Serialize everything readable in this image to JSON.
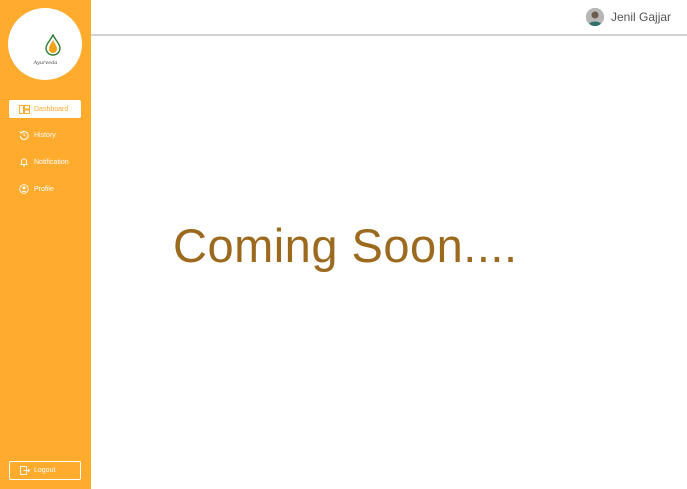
{
  "logo": {
    "text": "Ayurveda"
  },
  "sidebar": {
    "items": [
      {
        "label": "Dashboard",
        "icon": "dashboard-icon",
        "active": true
      },
      {
        "label": "History",
        "icon": "history-icon",
        "active": false
      },
      {
        "label": "Notification",
        "icon": "bell-icon",
        "active": false
      },
      {
        "label": "Profile",
        "icon": "user-circle-icon",
        "active": false
      }
    ],
    "logout_label": "Logout"
  },
  "header": {
    "user_name": "Jenil Gajjar"
  },
  "main": {
    "message": "Coming Soon...."
  },
  "colors": {
    "accent": "#ffab2e",
    "text_brown": "#9c6a1f"
  }
}
